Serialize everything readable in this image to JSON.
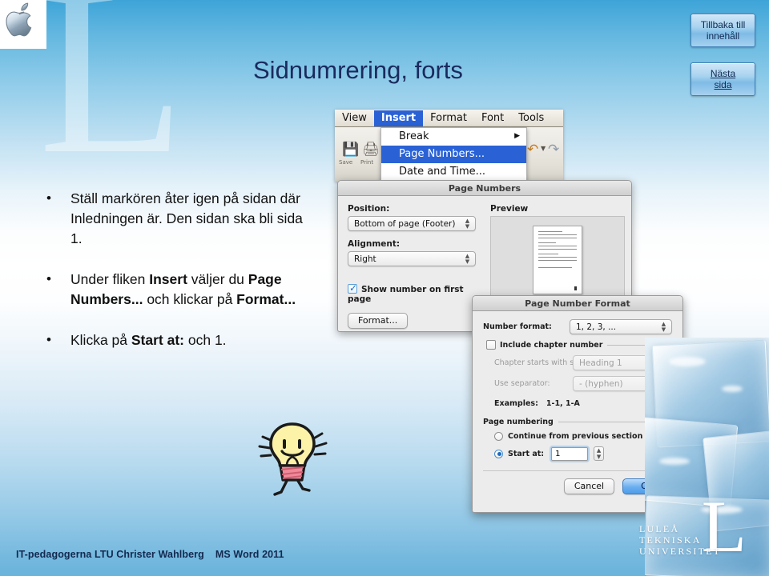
{
  "slide": {
    "title": "Sidnumrering, forts",
    "footer_left": "IT-pedagogerna LTU Christer Wahlberg",
    "footer_right": "MS Word 2011"
  },
  "nav": {
    "back_line1": "Tillbaka till",
    "back_line2": "innehåll",
    "next_line1": "Nästa",
    "next_line2": "sida"
  },
  "bullets": [
    {
      "parts": [
        {
          "text": "Ställ markören åter igen på sidan där Inledningen är. Den sidan ska bli sida 1.",
          "bold": false
        }
      ]
    },
    {
      "parts": [
        {
          "text": "Under fliken ",
          "bold": false
        },
        {
          "text": "Insert",
          "bold": true
        },
        {
          "text": " väljer du ",
          "bold": false
        },
        {
          "text": "Page Numbers...",
          "bold": true
        },
        {
          "text": " och klickar på ",
          "bold": false
        },
        {
          "text": "Format...",
          "bold": true
        }
      ]
    },
    {
      "parts": [
        {
          "text": "Klicka på ",
          "bold": false
        },
        {
          "text": "Start at:",
          "bold": true
        },
        {
          "text": " och 1.",
          "bold": false
        }
      ]
    }
  ],
  "menu_screenshot": {
    "menubar": [
      {
        "label": "View",
        "active": false
      },
      {
        "label": "Insert",
        "active": true
      },
      {
        "label": "Format",
        "active": false
      },
      {
        "label": "Font",
        "active": false
      },
      {
        "label": "Tools",
        "active": false
      }
    ],
    "toolbar": {
      "save_icon": "floppy-disk-icon",
      "save_label": "Save",
      "print_icon": "printer-icon",
      "print_label": "Print",
      "undo_icon": "undo-arrow-icon",
      "redo_icon": "redo-arrow-icon"
    },
    "dropdown": [
      {
        "label": "Break",
        "selected": false,
        "submenu": true,
        "arrow": "▶"
      },
      {
        "label": "Page Numbers...",
        "selected": true,
        "submenu": false
      },
      {
        "label": "Date and Time...",
        "selected": false,
        "submenu": false
      }
    ]
  },
  "page_numbers_dialog": {
    "title": "Page Numbers",
    "position_label": "Position:",
    "position_value": "Bottom of page (Footer)",
    "alignment_label": "Alignment:",
    "alignment_value": "Right",
    "show_first_page_label": "Show number on first page",
    "show_first_page_checked": true,
    "format_button": "Format...",
    "preview_label": "Preview"
  },
  "page_number_format_dialog": {
    "title": "Page Number Format",
    "number_format_label": "Number format:",
    "number_format_value": "1, 2, 3, ...",
    "include_chapter_label": "Include chapter number",
    "include_chapter_checked": false,
    "chapter_style_label": "Chapter starts with style",
    "chapter_style_value": "Heading 1",
    "separator_label": "Use separator:",
    "separator_value": "-    (hyphen)",
    "examples_label": "Examples:",
    "examples_value": "1-1, 1-A",
    "page_numbering_group": "Page numbering",
    "continue_label": "Continue from previous section",
    "continue_selected": false,
    "start_at_label": "Start at:",
    "start_at_selected": true,
    "start_at_value": "1",
    "cancel_button": "Cancel",
    "ok_button": "OK"
  },
  "branding": {
    "apple_logo": "apple-logo",
    "watermark_letter": "L",
    "ltu_letter": "L",
    "ltu_line1": "LULEÅ",
    "ltu_line2": "TEKNISKA",
    "ltu_line3": "UNIVERSITET"
  },
  "colors": {
    "title_blue": "#1a2a5e",
    "menu_highlight": "#2a62d6",
    "nav_button_border": "#3d7fb5",
    "primary_button": "#4e9cea"
  }
}
